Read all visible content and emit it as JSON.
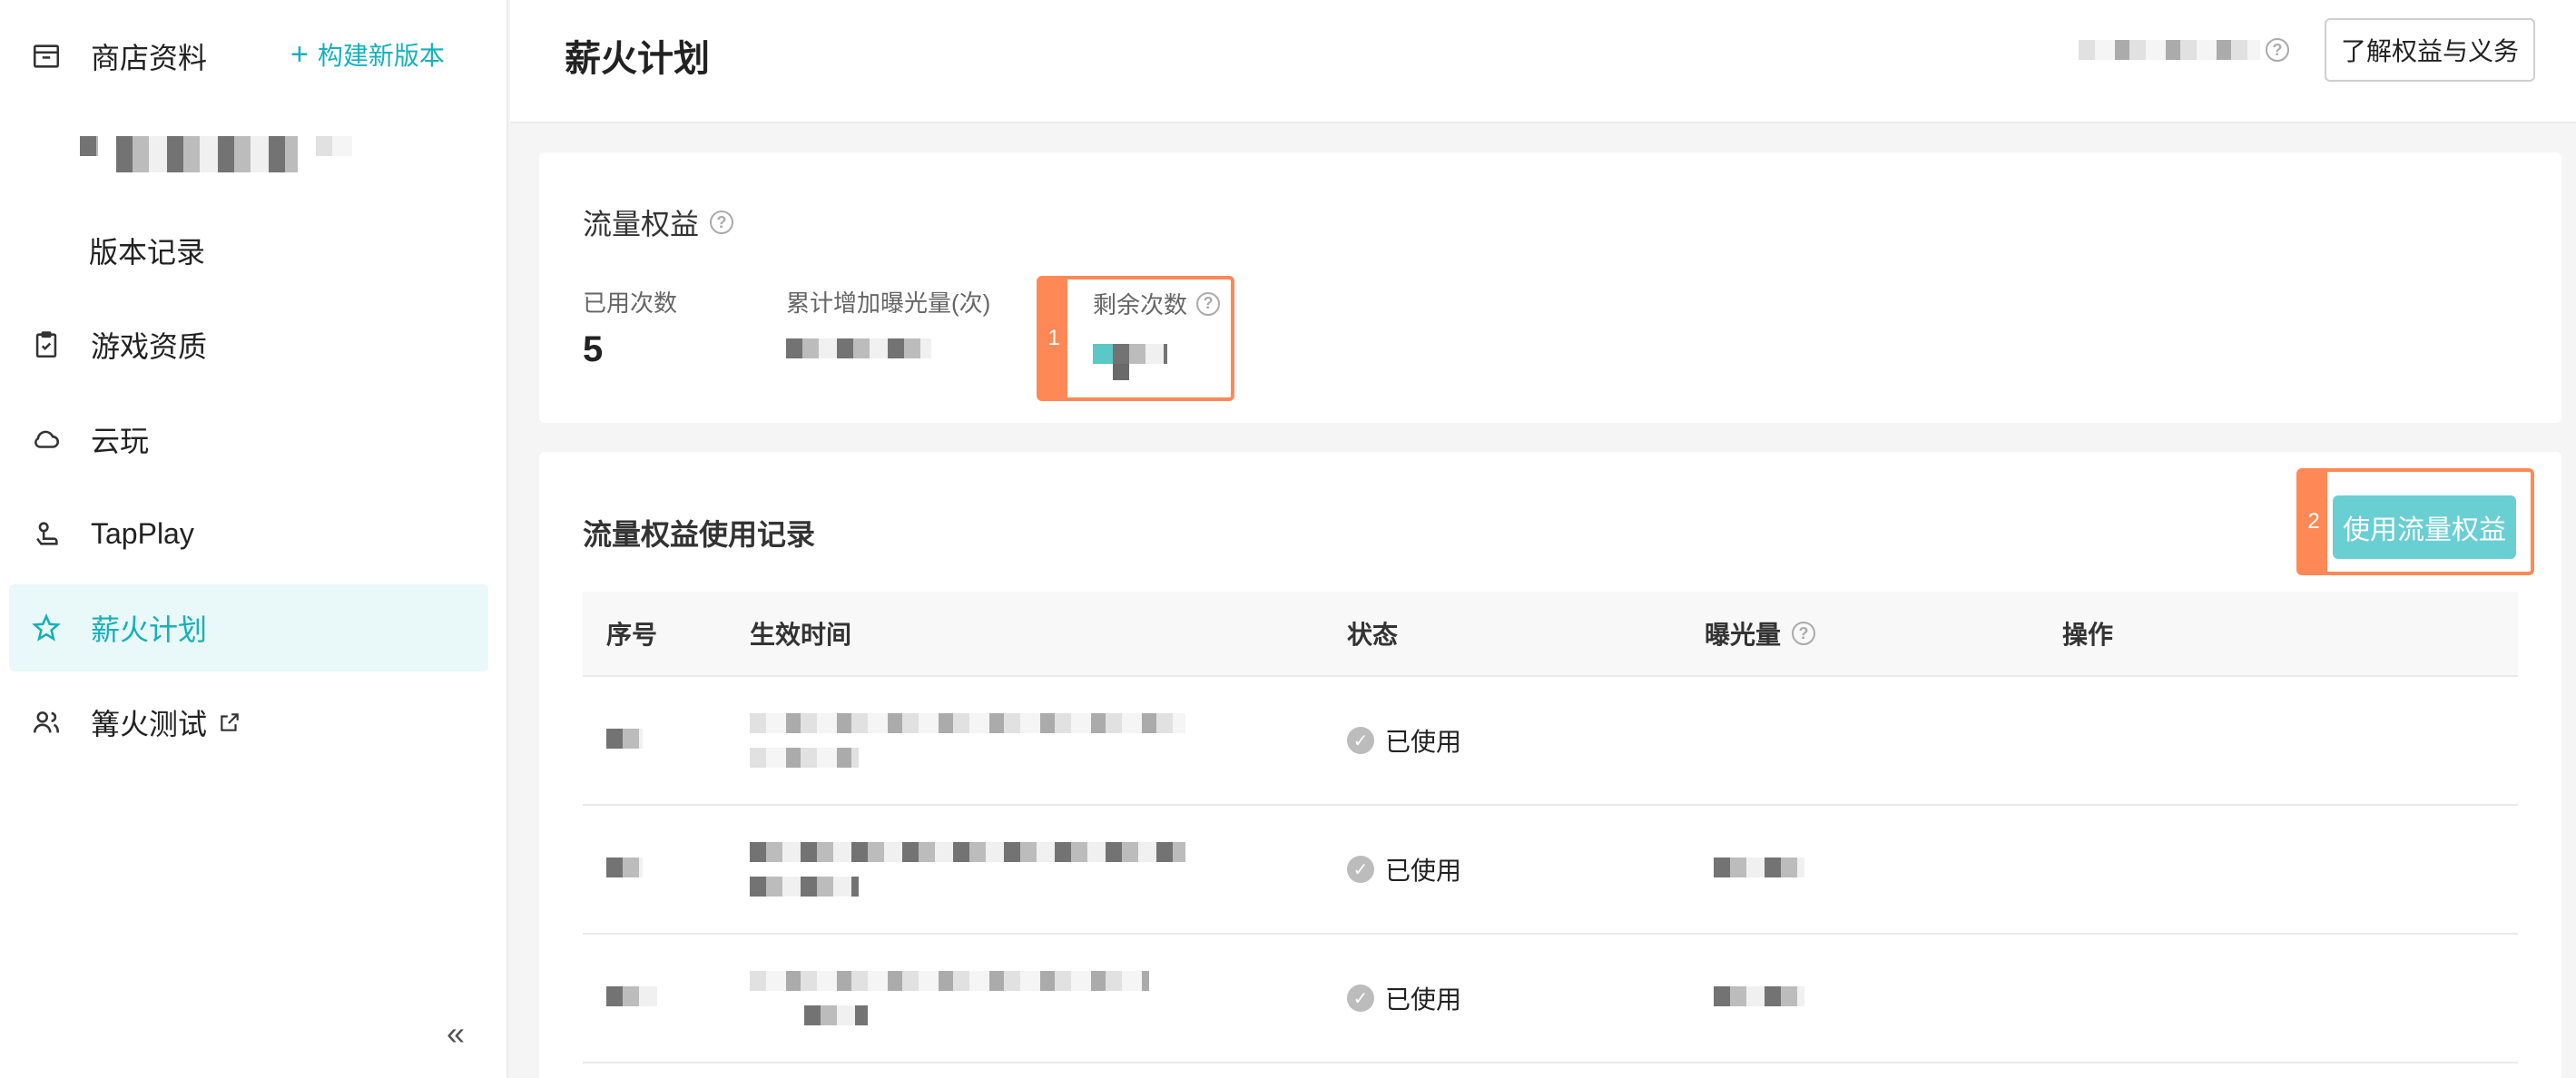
{
  "sidebar": {
    "build_button": "构建新版本",
    "items": [
      {
        "label": "商店资料"
      },
      {
        "label": "版本记录"
      },
      {
        "label": "游戏资质"
      },
      {
        "label": "云玩"
      },
      {
        "label": "TapPlay"
      },
      {
        "label": "薪火计划"
      },
      {
        "label": "篝火测试"
      }
    ],
    "collapse_glyph": "«",
    "active_color": "#15b1b8",
    "active_bg": "#e9f8f8"
  },
  "header": {
    "title": "薪火计划",
    "rights_button": "了解权益与义务"
  },
  "traffic": {
    "title": "流量权益",
    "used_label": "已用次数",
    "used_value": "5",
    "exposure_label": "累计增加曝光量(次)",
    "remaining_label": "剩余次数",
    "highlight_tag": "1"
  },
  "records": {
    "title": "流量权益使用记录",
    "use_button": "使用流量权益",
    "use_button_color": "#6acfd3",
    "highlight_tag": "2",
    "highlight_color": "#ff8956",
    "columns": [
      "序号",
      "生效时间",
      "状态",
      "曝光量",
      "操作"
    ],
    "rows": [
      {
        "status": "已使用"
      },
      {
        "status": "已使用"
      },
      {
        "status": "已使用"
      }
    ]
  }
}
